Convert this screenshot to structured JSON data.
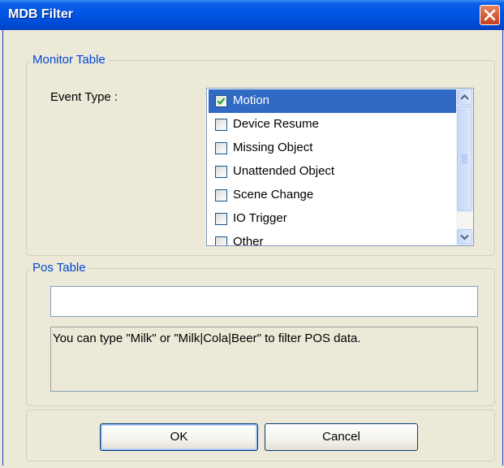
{
  "window": {
    "title": "MDB Filter",
    "close_icon": "close-icon"
  },
  "monitor_group": {
    "legend": "Monitor Table",
    "event_type_label": "Event Type :",
    "event_types": [
      {
        "label": "Motion",
        "checked": true,
        "selected": true
      },
      {
        "label": "Device Resume",
        "checked": false,
        "selected": false
      },
      {
        "label": "Missing Object",
        "checked": false,
        "selected": false
      },
      {
        "label": "Unattended Object",
        "checked": false,
        "selected": false
      },
      {
        "label": "Scene Change",
        "checked": false,
        "selected": false
      },
      {
        "label": "IO Trigger",
        "checked": false,
        "selected": false
      },
      {
        "label": "Other",
        "checked": false,
        "selected": false
      }
    ]
  },
  "pos_group": {
    "legend": "Pos Table",
    "filter_value": "",
    "hint": "You can type \"Milk\" or \"Milk|Cola|Beer\" to filter POS data."
  },
  "buttons": {
    "ok": "OK",
    "cancel": "Cancel"
  },
  "colors": {
    "title_bar": "#0054E3",
    "selection": "#316AC5",
    "legend_text": "#0046D5",
    "dialog_bg": "#ECE9D8",
    "close_button": "#D9532F"
  }
}
